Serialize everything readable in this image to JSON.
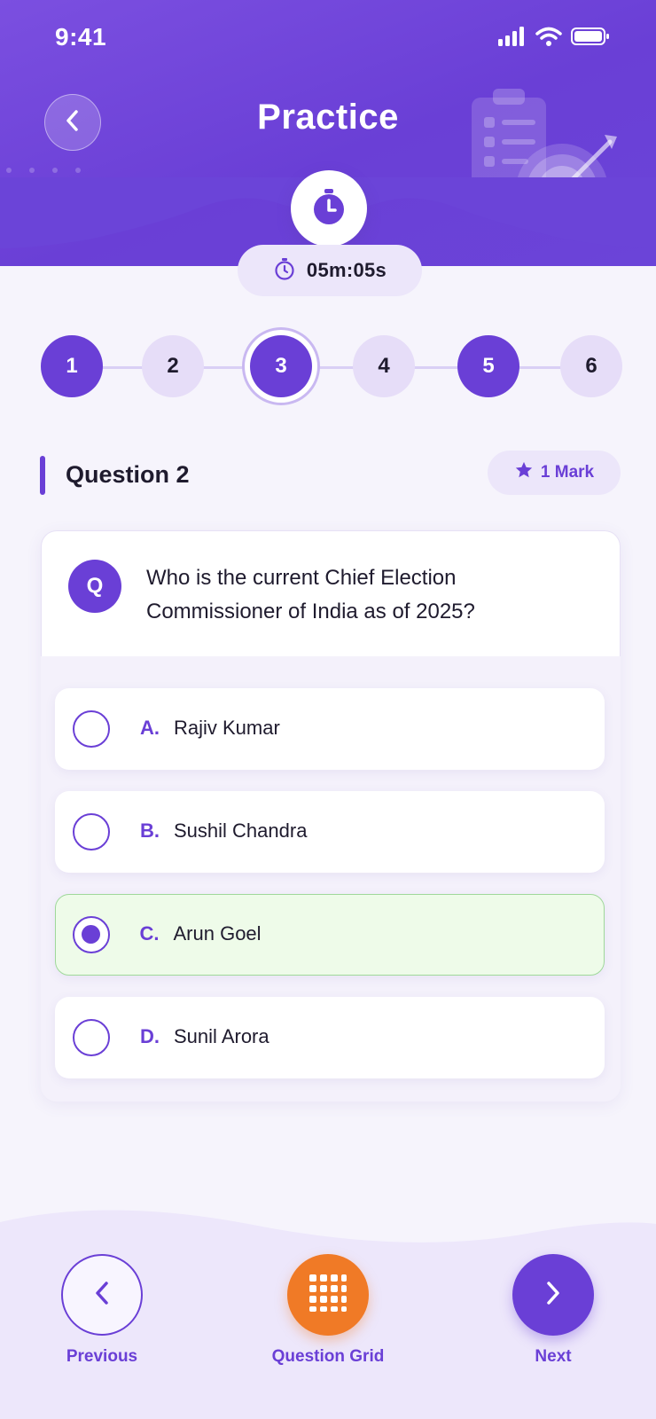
{
  "status_bar": {
    "time": "9:41"
  },
  "header": {
    "title": "Practice"
  },
  "timer": {
    "value": "05m:05s"
  },
  "stepper": {
    "steps": [
      {
        "label": "1",
        "state": "answered"
      },
      {
        "label": "2",
        "state": "unanswered"
      },
      {
        "label": "3",
        "state": "current"
      },
      {
        "label": "4",
        "state": "unanswered"
      },
      {
        "label": "5",
        "state": "answered"
      },
      {
        "label": "6",
        "state": "unanswered"
      }
    ]
  },
  "question": {
    "heading": "Question 2",
    "marks": "1 Mark",
    "badge": "Q",
    "text": "Who is the current Chief Election Commissioner of India as of 2025?",
    "options": [
      {
        "letter": "A.",
        "text": "Rajiv Kumar",
        "selected": false
      },
      {
        "letter": "B.",
        "text": "Sushil Chandra",
        "selected": false
      },
      {
        "letter": "C.",
        "text": "Arun Goel",
        "selected": true
      },
      {
        "letter": "D.",
        "text": "Sunil Arora",
        "selected": false
      }
    ]
  },
  "bottom_nav": {
    "previous": "Previous",
    "grid": "Question Grid",
    "next": "Next"
  },
  "colors": {
    "primary": "#6a3fd6",
    "accent_orange": "#f07a26",
    "selected_bg": "#eefbe9",
    "selected_border": "#9fd89a"
  },
  "icons": {
    "back": "chevron-left-icon",
    "timer": "stopwatch-icon",
    "mark": "star-icon",
    "prev": "chevron-left-icon",
    "grid": "grid-icon",
    "next": "chevron-right-icon"
  }
}
